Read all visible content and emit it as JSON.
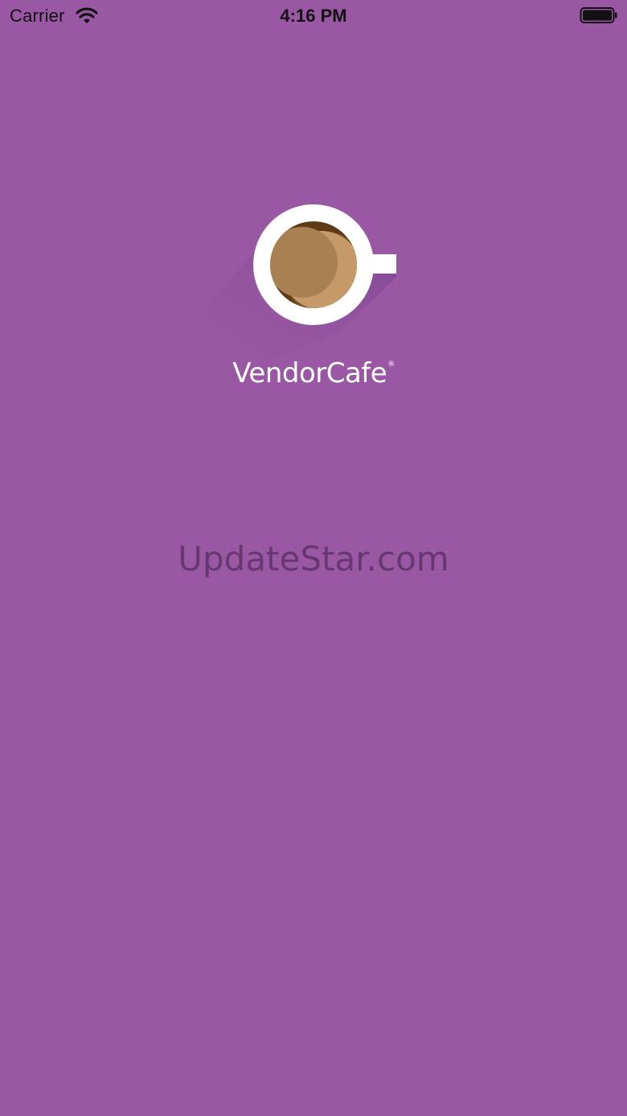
{
  "status_bar": {
    "carrier": "Carrier",
    "time": "4:16 PM"
  },
  "brand": {
    "name": "VendorCafe",
    "mark": "®"
  },
  "watermark": "UpdateStar.com",
  "colors": {
    "background": "#9a57a3",
    "cup": "#ffffff",
    "coffee_light": "#c69a68",
    "coffee_mid": "#a98052",
    "coffee_dark": "#5e3a17"
  }
}
